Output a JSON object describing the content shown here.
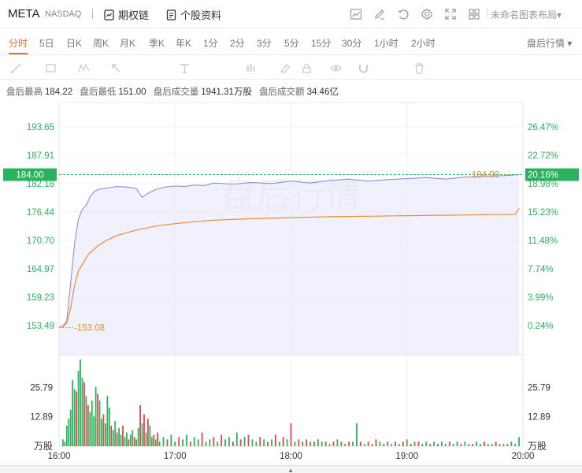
{
  "header": {
    "ticker": "META",
    "exchange": "NASDAQ",
    "options_chain": "期权链",
    "stock_info": "个股资料",
    "layout_name": "未命名图表布局",
    "layout_arrow": "▾"
  },
  "toolbar": {
    "icons": [
      "chart-type-icon",
      "draw-icon",
      "undo-icon",
      "settings-icon",
      "fullscreen-icon",
      "grid-layout-icon"
    ]
  },
  "periods": {
    "items": [
      "分时",
      "5日",
      "日K",
      "周K",
      "月K",
      "季K",
      "年K",
      "1分",
      "2分",
      "3分",
      "5分",
      "15分",
      "30分",
      "1小时",
      "2小时"
    ],
    "active": "分时",
    "session_menu": "盘后行情 ▾"
  },
  "drawing_tools": [
    "trend-line-icon",
    "rectangle-icon",
    "pattern-icon",
    "arrow-icon",
    "text-icon",
    "measure-icon",
    "eraser-icon",
    "lock-icon",
    "eye-icon",
    "magnet-icon",
    "trash-icon"
  ],
  "stats": {
    "high_label": "盘后最高",
    "high": "184.22",
    "low_label": "盘后最低",
    "low": "151.00",
    "volume_label": "盘后成交量",
    "volume": "1941.31万股",
    "amount_label": "盘后成交额",
    "amount": "34.46亿"
  },
  "chart_data": {
    "type": "line",
    "watermark": "盘后行情",
    "colors": {
      "price_line": "#8e8ed4",
      "avg_line": "#ef8c2c",
      "area_fill": "#e8e8fb",
      "axis_text": "#2ab35e",
      "current_price_line": "#2ab35e",
      "vol_up": "#2ab35e",
      "vol_down": "#e8454a"
    },
    "x": {
      "ticks": [
        "16:00",
        "17:00",
        "18:00",
        "19:00",
        "20:00"
      ],
      "start_minutes": 960,
      "end_minutes": 1200
    },
    "y": {
      "ticks": [
        "193.65",
        "187.91",
        "182.18",
        "176.44",
        "170.70",
        "164.97",
        "159.23",
        "153.49"
      ],
      "right_ticks": [
        "26.47%",
        "22.72%",
        "18.98%",
        "15.23%",
        "11.48%",
        "7.74%",
        "3.99%",
        "0.24%"
      ],
      "ylim": [
        153.49,
        193.65
      ]
    },
    "current_price": "184.00",
    "current_pct": "20.16%",
    "current_value": 184.0,
    "start_annotation": "153.08",
    "start_value": 153.08,
    "price_series": [
      [
        960,
        153.1
      ],
      [
        962,
        153.4
      ],
      [
        964,
        154.5
      ],
      [
        966,
        162
      ],
      [
        968,
        170
      ],
      [
        970,
        175
      ],
      [
        972,
        177
      ],
      [
        974,
        177.8
      ],
      [
        976,
        179.5
      ],
      [
        978,
        180.5
      ],
      [
        980,
        181
      ],
      [
        985,
        181.3
      ],
      [
        990,
        181.6
      ],
      [
        995,
        181.5
      ],
      [
        1000,
        181.2
      ],
      [
        1003,
        179.4
      ],
      [
        1006,
        180.2
      ],
      [
        1010,
        181
      ],
      [
        1015,
        181.5
      ],
      [
        1020,
        181.7
      ],
      [
        1025,
        181.6
      ],
      [
        1030,
        181.9
      ],
      [
        1035,
        181.8
      ],
      [
        1040,
        182.3
      ],
      [
        1050,
        182.1
      ],
      [
        1060,
        182.4
      ],
      [
        1070,
        182.2
      ],
      [
        1080,
        182.7
      ],
      [
        1090,
        182.3
      ],
      [
        1100,
        182.8
      ],
      [
        1110,
        183.1
      ],
      [
        1120,
        182.7
      ],
      [
        1130,
        183
      ],
      [
        1140,
        183.2
      ],
      [
        1150,
        183.4
      ],
      [
        1160,
        183.1
      ],
      [
        1170,
        183.5
      ],
      [
        1180,
        183.7
      ],
      [
        1190,
        183.8
      ],
      [
        1198,
        184.0
      ]
    ],
    "avg_series": [
      [
        960,
        153.1
      ],
      [
        962,
        153.3
      ],
      [
        964,
        154
      ],
      [
        966,
        157
      ],
      [
        968,
        161.5
      ],
      [
        970,
        164.5
      ],
      [
        975,
        167.8
      ],
      [
        980,
        169.6
      ],
      [
        985,
        170.8
      ],
      [
        990,
        171.7
      ],
      [
        1000,
        172.8
      ],
      [
        1010,
        173.6
      ],
      [
        1020,
        174.1
      ],
      [
        1030,
        174.5
      ],
      [
        1040,
        174.8
      ],
      [
        1060,
        175.1
      ],
      [
        1080,
        175.3
      ],
      [
        1100,
        175.5
      ],
      [
        1120,
        175.6
      ],
      [
        1140,
        175.7
      ],
      [
        1160,
        175.8
      ],
      [
        1180,
        175.9
      ],
      [
        1196,
        176.0
      ],
      [
        1198,
        177.2
      ]
    ],
    "volume_axis": {
      "ticks": [
        "25.79",
        "12.89"
      ],
      "unit": "万股",
      "max": 38.68
    },
    "volume_bars": [
      [
        962,
        3,
        "up"
      ],
      [
        963,
        2,
        "up"
      ],
      [
        964,
        9,
        "up"
      ],
      [
        965,
        12,
        "up"
      ],
      [
        966,
        16,
        "up"
      ],
      [
        967,
        29,
        "up"
      ],
      [
        968,
        25,
        "up"
      ],
      [
        969,
        24,
        "down"
      ],
      [
        970,
        33,
        "up"
      ],
      [
        971,
        38,
        "up"
      ],
      [
        972,
        30,
        "up"
      ],
      [
        973,
        28,
        "down"
      ],
      [
        974,
        22,
        "up"
      ],
      [
        975,
        18,
        "down"
      ],
      [
        976,
        15,
        "up"
      ],
      [
        977,
        20,
        "up"
      ],
      [
        978,
        13,
        "up"
      ],
      [
        979,
        26,
        "up"
      ],
      [
        980,
        23,
        "down"
      ],
      [
        981,
        20,
        "up"
      ],
      [
        982,
        12,
        "up"
      ],
      [
        983,
        14,
        "down"
      ],
      [
        984,
        10,
        "up"
      ],
      [
        985,
        22,
        "up"
      ],
      [
        986,
        17,
        "up"
      ],
      [
        987,
        9,
        "down"
      ],
      [
        988,
        7,
        "up"
      ],
      [
        989,
        11,
        "up"
      ],
      [
        990,
        6,
        "down"
      ],
      [
        991,
        8,
        "up"
      ],
      [
        992,
        5,
        "up"
      ],
      [
        993,
        9,
        "down"
      ],
      [
        994,
        4,
        "up"
      ],
      [
        995,
        6,
        "up"
      ],
      [
        996,
        3,
        "down"
      ],
      [
        997,
        5,
        "up"
      ],
      [
        998,
        7,
        "up"
      ],
      [
        999,
        4,
        "down"
      ],
      [
        1000,
        3,
        "up"
      ],
      [
        1001,
        8,
        "up"
      ],
      [
        1002,
        18,
        "down"
      ],
      [
        1003,
        10,
        "up"
      ],
      [
        1004,
        14,
        "down"
      ],
      [
        1005,
        6,
        "up"
      ],
      [
        1006,
        12,
        "down"
      ],
      [
        1007,
        9,
        "up"
      ],
      [
        1008,
        4,
        "up"
      ],
      [
        1009,
        5,
        "down"
      ],
      [
        1010,
        3,
        "up"
      ],
      [
        1011,
        6,
        "down"
      ],
      [
        1012,
        2,
        "up"
      ],
      [
        1014,
        4,
        "up"
      ],
      [
        1016,
        3,
        "down"
      ],
      [
        1018,
        5,
        "up"
      ],
      [
        1020,
        2,
        "up"
      ],
      [
        1022,
        4,
        "down"
      ],
      [
        1024,
        3,
        "up"
      ],
      [
        1026,
        5,
        "up"
      ],
      [
        1028,
        2,
        "down"
      ],
      [
        1030,
        4,
        "up"
      ],
      [
        1032,
        3,
        "up"
      ],
      [
        1034,
        6,
        "down"
      ],
      [
        1036,
        2,
        "up"
      ],
      [
        1038,
        3,
        "up"
      ],
      [
        1040,
        4,
        "down"
      ],
      [
        1042,
        2,
        "up"
      ],
      [
        1044,
        5,
        "down"
      ],
      [
        1046,
        3,
        "up"
      ],
      [
        1048,
        4,
        "up"
      ],
      [
        1050,
        2,
        "down"
      ],
      [
        1052,
        6,
        "up"
      ],
      [
        1054,
        3,
        "down"
      ],
      [
        1056,
        4,
        "up"
      ],
      [
        1058,
        5,
        "down"
      ],
      [
        1060,
        3,
        "up"
      ],
      [
        1062,
        2,
        "up"
      ],
      [
        1064,
        4,
        "down"
      ],
      [
        1066,
        3,
        "up"
      ],
      [
        1068,
        2,
        "down"
      ],
      [
        1070,
        3,
        "up"
      ],
      [
        1072,
        5,
        "down"
      ],
      [
        1074,
        2,
        "up"
      ],
      [
        1076,
        4,
        "down"
      ],
      [
        1078,
        3,
        "up"
      ],
      [
        1080,
        10,
        "down"
      ],
      [
        1082,
        2,
        "up"
      ],
      [
        1084,
        3,
        "down"
      ],
      [
        1086,
        2,
        "up"
      ],
      [
        1088,
        3,
        "down"
      ],
      [
        1090,
        2,
        "up"
      ],
      [
        1092,
        2,
        "down"
      ],
      [
        1094,
        3,
        "up"
      ],
      [
        1096,
        2,
        "up"
      ],
      [
        1098,
        2,
        "down"
      ],
      [
        1100,
        1,
        "up"
      ],
      [
        1102,
        2,
        "down"
      ],
      [
        1104,
        3,
        "up"
      ],
      [
        1106,
        2,
        "down"
      ],
      [
        1108,
        1,
        "up"
      ],
      [
        1110,
        2,
        "down"
      ],
      [
        1112,
        2,
        "up"
      ],
      [
        1114,
        10,
        "up"
      ],
      [
        1116,
        2,
        "down"
      ],
      [
        1118,
        1,
        "up"
      ],
      [
        1120,
        2,
        "down"
      ],
      [
        1122,
        1,
        "up"
      ],
      [
        1124,
        3,
        "down"
      ],
      [
        1126,
        2,
        "up"
      ],
      [
        1128,
        1,
        "down"
      ],
      [
        1130,
        2,
        "up"
      ],
      [
        1132,
        1,
        "up"
      ],
      [
        1134,
        2,
        "down"
      ],
      [
        1136,
        1,
        "up"
      ],
      [
        1138,
        2,
        "down"
      ],
      [
        1140,
        3,
        "up"
      ],
      [
        1142,
        1,
        "down"
      ],
      [
        1144,
        2,
        "up"
      ],
      [
        1146,
        2,
        "down"
      ],
      [
        1148,
        1,
        "up"
      ],
      [
        1150,
        2,
        "up"
      ],
      [
        1152,
        1,
        "down"
      ],
      [
        1154,
        2,
        "up"
      ],
      [
        1156,
        1,
        "down"
      ],
      [
        1158,
        2,
        "up"
      ],
      [
        1160,
        1,
        "up"
      ],
      [
        1162,
        2,
        "down"
      ],
      [
        1164,
        1,
        "up"
      ],
      [
        1166,
        2,
        "up"
      ],
      [
        1168,
        1,
        "down"
      ],
      [
        1170,
        2,
        "up"
      ],
      [
        1172,
        1,
        "up"
      ],
      [
        1174,
        1,
        "down"
      ],
      [
        1176,
        2,
        "up"
      ],
      [
        1178,
        1,
        "up"
      ],
      [
        1180,
        2,
        "down"
      ],
      [
        1182,
        1,
        "up"
      ],
      [
        1184,
        1,
        "up"
      ],
      [
        1186,
        2,
        "down"
      ],
      [
        1188,
        1,
        "up"
      ],
      [
        1190,
        1,
        "up"
      ],
      [
        1192,
        1,
        "down"
      ],
      [
        1194,
        2,
        "up"
      ],
      [
        1196,
        1,
        "up"
      ],
      [
        1198,
        4,
        "up"
      ]
    ]
  }
}
